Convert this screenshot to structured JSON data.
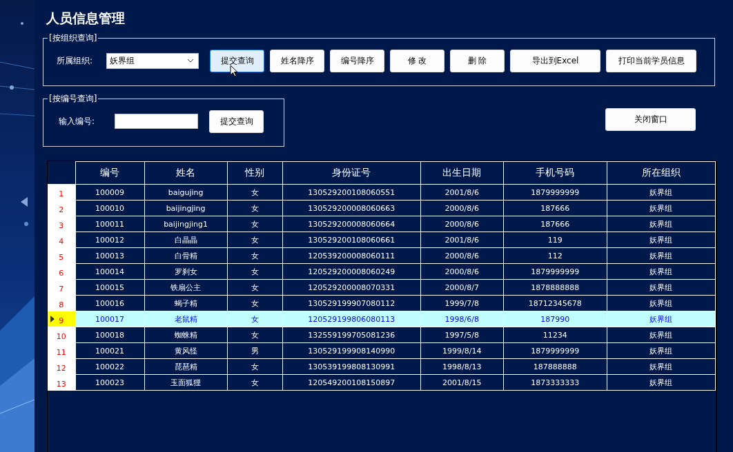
{
  "title": "人员信息管理",
  "org_query": {
    "legend": "[按组织查询]",
    "label": "所属组织:",
    "select_value": "妖界组",
    "buttons": [
      {
        "label": "提交查询",
        "hovered": true
      },
      {
        "label": "姓名降序",
        "hovered": false
      },
      {
        "label": "编号降序",
        "hovered": false
      },
      {
        "label": "修 改",
        "hovered": false
      },
      {
        "label": "删 除",
        "hovered": false
      },
      {
        "label": "导出到Excel",
        "hovered": false
      },
      {
        "label": "打印当前学员信息",
        "hovered": false
      }
    ]
  },
  "id_query": {
    "legend": "[按编号查询]",
    "label": "输入编号:",
    "button": "提交查询"
  },
  "close_button": "关闭窗口",
  "table": {
    "columns": [
      "编号",
      "姓名",
      "性别",
      "身份证号",
      "出生日期",
      "手机号码",
      "所在组织"
    ],
    "rows": [
      {
        "index": "1",
        "selected": false,
        "cells": [
          "100009",
          "baigujing",
          "女",
          "130529200108060551",
          "2001/8/6",
          "1879999999",
          "妖界组"
        ]
      },
      {
        "index": "2",
        "selected": false,
        "cells": [
          "100010",
          "baijingjing",
          "女",
          "130529200008060663",
          "2000/8/6",
          "187666",
          "妖界组"
        ]
      },
      {
        "index": "3",
        "selected": false,
        "cells": [
          "100011",
          "baijingjing1",
          "女",
          "130529200008060664",
          "2000/8/6",
          "187666",
          "妖界组"
        ]
      },
      {
        "index": "4",
        "selected": false,
        "cells": [
          "100012",
          "白晶晶",
          "女",
          "130529200108060661",
          "2001/8/6",
          "119",
          "妖界组"
        ]
      },
      {
        "index": "5",
        "selected": false,
        "cells": [
          "100013",
          "白骨精",
          "女",
          "120539200008060111",
          "2000/8/6",
          "112",
          "妖界组"
        ]
      },
      {
        "index": "6",
        "selected": false,
        "cells": [
          "100014",
          "罗刹女",
          "女",
          "120529200008060249",
          "2000/8/6",
          "1879999999",
          "妖界组"
        ]
      },
      {
        "index": "7",
        "selected": false,
        "cells": [
          "100015",
          "铁扇公主",
          "女",
          "120529200008070331",
          "2000/8/7",
          "1878888888",
          "妖界组"
        ]
      },
      {
        "index": "8",
        "selected": false,
        "cells": [
          "100016",
          "蝎子精",
          "女",
          "130529199907080112",
          "1999/7/8",
          "18712345678",
          "妖界组"
        ]
      },
      {
        "index": "9",
        "selected": true,
        "cells": [
          "100017",
          "老鼠精",
          "女",
          "120529199806080113",
          "1998/6/8",
          "187990",
          "妖界组"
        ]
      },
      {
        "index": "10",
        "selected": false,
        "cells": [
          "100018",
          "蜘蛛精",
          "女",
          "132559199705081236",
          "1997/5/8",
          "11234",
          "妖界组"
        ]
      },
      {
        "index": "11",
        "selected": false,
        "cells": [
          "100021",
          "黄风怪",
          "男",
          "130529199908140990",
          "1999/8/14",
          "1879999999",
          "妖界组"
        ]
      },
      {
        "index": "12",
        "selected": false,
        "cells": [
          "100022",
          "琵琶精",
          "女",
          "130539199808130991",
          "1998/8/13",
          "187888888",
          "妖界组"
        ]
      },
      {
        "index": "13",
        "selected": false,
        "cells": [
          "100023",
          "玉面狐狸",
          "女",
          "120549200108150897",
          "2001/8/15",
          "1873333333",
          "妖界组"
        ]
      }
    ]
  }
}
